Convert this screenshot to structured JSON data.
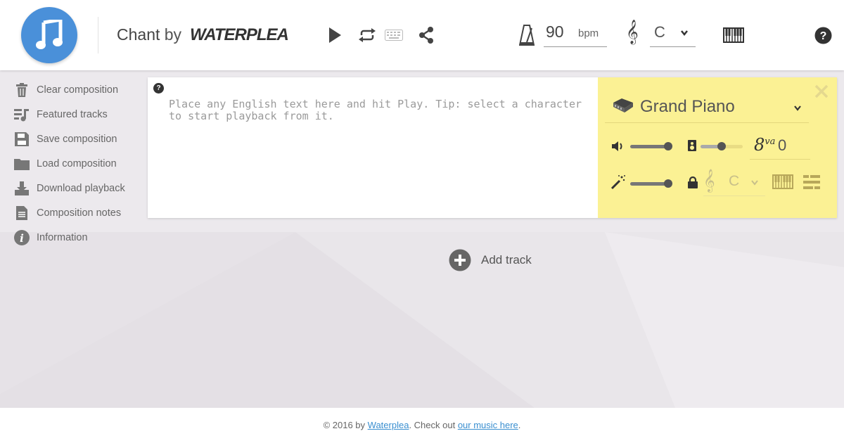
{
  "header": {
    "title": "Chant",
    "by": "by",
    "brand": "WATERPLEA",
    "bpm_value": "90",
    "bpm_unit": "bpm",
    "key_value": "C"
  },
  "sidebar": {
    "items": [
      {
        "label": "Clear composition",
        "icon": "trash-icon"
      },
      {
        "label": "Featured tracks",
        "icon": "playlist-icon"
      },
      {
        "label": "Save composition",
        "icon": "save-icon"
      },
      {
        "label": "Load composition",
        "icon": "folder-icon"
      },
      {
        "label": "Download playback",
        "icon": "download-icon"
      },
      {
        "label": "Composition notes",
        "icon": "notes-icon"
      },
      {
        "label": "Information",
        "icon": "info-icon"
      }
    ]
  },
  "track": {
    "help": "?",
    "placeholder": "Place any English text here and hit Play. Tip: select a character to start playback from it.",
    "instrument": "Grand Piano",
    "volume_level": 0.9,
    "pan_level": 0.5,
    "octave_label": "8",
    "octave_sup": "va",
    "octave_value": "0",
    "effect_level": 0.9,
    "lock_key": "C"
  },
  "add_track": {
    "label": "Add track"
  },
  "footer": {
    "prefix": "© 2016 by ",
    "link1": "Waterplea",
    "middle": ". Check out ",
    "link2": "our music here",
    "suffix": "."
  },
  "colors": {
    "logo": "#4a90d9",
    "panel": "#fbf194",
    "link": "#3a8fd0"
  }
}
